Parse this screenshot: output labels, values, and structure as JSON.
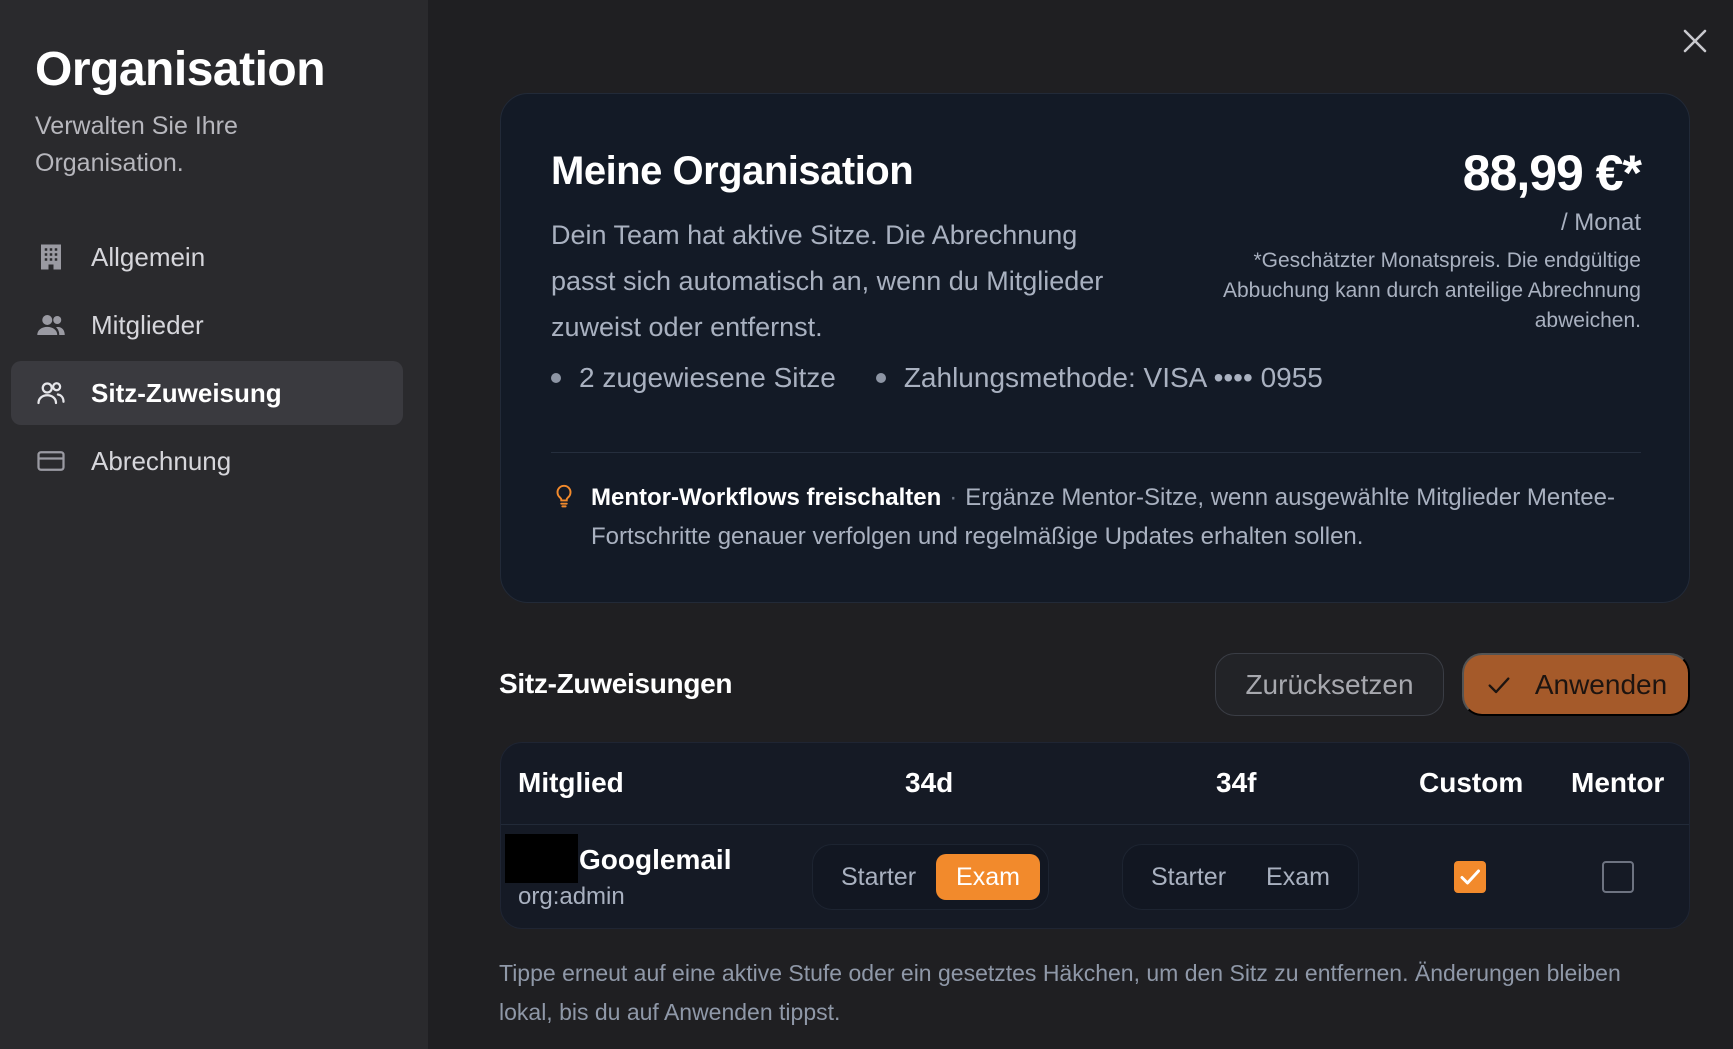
{
  "sidebar": {
    "title": "Organisation",
    "subtitle": "Verwalten Sie Ihre Organisation.",
    "items": [
      {
        "label": "Allgemein",
        "icon": "building-icon",
        "active": false
      },
      {
        "label": "Mitglieder",
        "icon": "users-icon",
        "active": false
      },
      {
        "label": "Sitz-Zuweisung",
        "icon": "user-group-outline-icon",
        "active": true
      },
      {
        "label": "Abrechnung",
        "icon": "credit-card-icon",
        "active": false
      }
    ]
  },
  "close_icon": "close-icon",
  "org_card": {
    "title": "Meine Organisation",
    "description": "Dein Team hat aktive Sitze. Die Abrechnung passt sich automatisch an, wenn du Mitglieder zuweist oder entfernst.",
    "price": "88,99 €*",
    "per": "/ Monat",
    "note": "*Geschätzter Monatspreis. Die endgültige Abbuchung kann durch anteilige Abrechnung abweichen.",
    "seats": "2 zugewiesene Sitze",
    "payment": "Zahlungsmethode: VISA •••• 0955",
    "tip_title": "Mentor-Workflows freischalten",
    "tip_separator": "·",
    "tip_text": "Ergänze Mentor-Sitze, wenn ausgewählte Mitglieder Mentee-Fortschritte genauer verfolgen und regelmäßige Updates erhalten sollen."
  },
  "assignments": {
    "title": "Sitz-Zuweisungen",
    "reset_label": "Zurücksetzen",
    "apply_label": "Anwenden",
    "columns": {
      "member": "Mitglied",
      "c34d": "34d",
      "c34f": "34f",
      "custom": "Custom",
      "mentor": "Mentor"
    },
    "rows": [
      {
        "name": "Googlemail",
        "role": "org:admin",
        "34d": {
          "starter": "Starter",
          "exam": "Exam",
          "selected": "Exam"
        },
        "34f": {
          "starter": "Starter",
          "exam": "Exam",
          "selected": null
        },
        "custom": true,
        "mentor": false
      }
    ],
    "footnote": "Tippe erneut auf eine aktive Stufe oder ein gesetztes Häkchen, um den Sitz zu entfernen. Änderungen bleiben lokal, bis du auf Anwenden tippst."
  },
  "colors": {
    "accent": "#f28a2c",
    "apply_button": "#a55a2a",
    "card_bg": "#131a26",
    "sidebar_bg": "#2a2a2d"
  }
}
